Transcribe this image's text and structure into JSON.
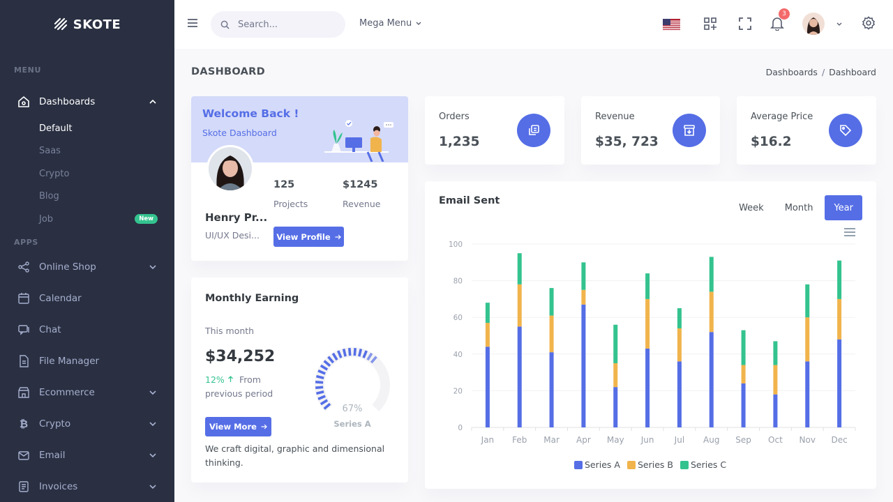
{
  "app": {
    "logo_text": "SKOTE"
  },
  "sidebar": {
    "menu_title": "MENU",
    "apps_title": "APPS",
    "dashboards": {
      "label": "Dashboards",
      "children": [
        "Default",
        "Saas",
        "Crypto",
        "Blog",
        "Job"
      ],
      "job_badge": "New"
    },
    "apps": [
      "Online Shop",
      "Calendar",
      "Chat",
      "File Manager",
      "Ecommerce",
      "Crypto",
      "Email",
      "Invoices"
    ]
  },
  "topbar": {
    "search_placeholder": "Search...",
    "mega_menu": "Mega Menu",
    "notification_count": "3"
  },
  "page": {
    "title": "DASHBOARD",
    "breadcrumb": [
      "Dashboards",
      "Dashboard"
    ]
  },
  "welcome": {
    "title": "Welcome Back !",
    "subtitle": "Skote Dashboard",
    "name": "Henry Pr...",
    "role": "UI/UX Desi...",
    "projects_value": "125",
    "projects_label": "Projects",
    "revenue_value": "$1245",
    "revenue_label": "Revenue",
    "button": "View Profile"
  },
  "stats": [
    {
      "label": "Orders",
      "value": "1,235",
      "icon": "copy-icon"
    },
    {
      "label": "Revenue",
      "value": "$35, 723",
      "icon": "archive-icon"
    },
    {
      "label": "Average Price",
      "value": "$16.2",
      "icon": "tag-icon"
    }
  ],
  "earning": {
    "title": "Monthly Earning",
    "subtitle": "This month",
    "value": "$34,252",
    "change": "12%",
    "from": "From",
    "period": "previous period",
    "button": "View More",
    "description": "We craft digital, graphic and dimensional thinking.",
    "gauge_value": 67,
    "gauge_label": "67%",
    "gauge_series": "Series A"
  },
  "email_chart": {
    "title": "Email Sent",
    "tabs": [
      "Week",
      "Month",
      "Year"
    ],
    "active_tab": "Year"
  },
  "chart_data": {
    "type": "bar",
    "stacked": true,
    "categories": [
      "Jan",
      "Feb",
      "Mar",
      "Apr",
      "May",
      "Jun",
      "Jul",
      "Aug",
      "Sep",
      "Oct",
      "Nov",
      "Dec"
    ],
    "series": [
      {
        "name": "Series A",
        "color": "#556ee6",
        "values": [
          44,
          55,
          41,
          67,
          22,
          43,
          36,
          52,
          24,
          18,
          36,
          48
        ]
      },
      {
        "name": "Series B",
        "color": "#f1b44c",
        "values": [
          13,
          23,
          20,
          8,
          13,
          27,
          18,
          22,
          10,
          16,
          24,
          22
        ]
      },
      {
        "name": "Series C",
        "color": "#34c38f",
        "values": [
          11,
          17,
          15,
          15,
          21,
          14,
          11,
          19,
          19,
          13,
          18,
          21
        ]
      }
    ],
    "ylim": [
      0,
      100
    ],
    "yticks": [
      0,
      20,
      40,
      60,
      80,
      100
    ],
    "grid": true,
    "legend": "bottom"
  }
}
